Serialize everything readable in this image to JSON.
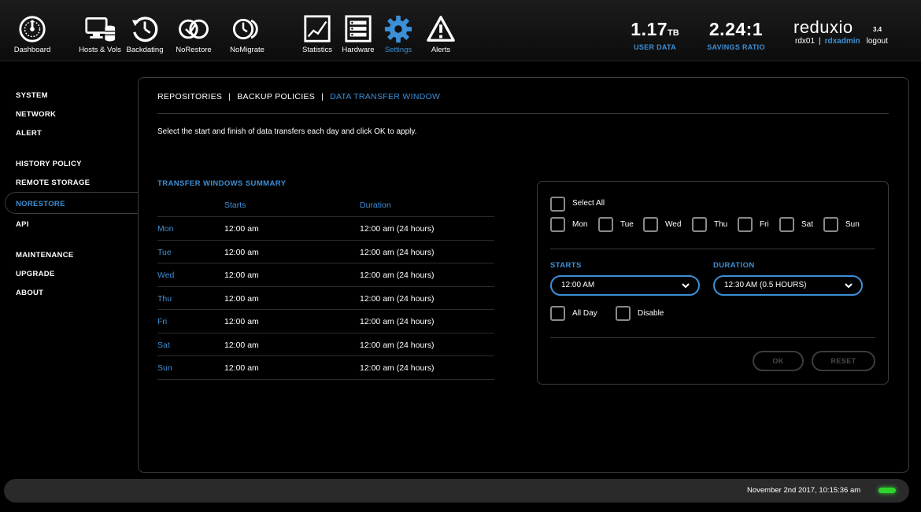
{
  "nav": {
    "items": [
      {
        "label": "Dashboard",
        "icon": "dashboard-gauge-icon"
      },
      {
        "label": "Hosts & Vols",
        "icon": "hosts-volumes-icon"
      },
      {
        "label": "Backdating",
        "icon": "backdating-clock-icon"
      },
      {
        "label": "NoRestore",
        "icon": "norestore-icon"
      },
      {
        "label": "NoMigrate",
        "icon": "nomigrate-icon"
      },
      {
        "label": "Statistics",
        "icon": "statistics-chart-icon"
      },
      {
        "label": "Hardware",
        "icon": "hardware-server-icon"
      },
      {
        "label": "Settings",
        "icon": "gear-icon"
      },
      {
        "label": "Alerts",
        "icon": "warning-icon"
      }
    ],
    "active": "Settings"
  },
  "stats": {
    "user_data": {
      "value": "1.17",
      "unit": "TB",
      "caption": "USER DATA"
    },
    "savings": {
      "value": "2.24:1",
      "caption": "SAVINGS RATIO"
    }
  },
  "brand": {
    "name": "reduxio",
    "version": "3.4"
  },
  "user": {
    "system": "rdx01",
    "separator": "|",
    "name": "rdxadmin",
    "logout": "logout"
  },
  "sidebar": {
    "items": [
      {
        "label": "SYSTEM"
      },
      {
        "label": "NETWORK"
      },
      {
        "label": "ALERT"
      },
      {
        "label": "HISTORY POLICY"
      },
      {
        "label": "REMOTE STORAGE"
      },
      {
        "label": "NORESTORE"
      },
      {
        "label": "API"
      },
      {
        "label": "MAINTENANCE"
      },
      {
        "label": "UPGRADE"
      },
      {
        "label": "ABOUT"
      }
    ],
    "active": "NORESTORE"
  },
  "tabs": {
    "repositories": "REPOSITORIES",
    "backup_policies": "BACKUP POLICIES",
    "data_transfer_window": "DATA TRANSFER WINDOW",
    "separator": "|"
  },
  "instructions": "Select the start and finish of data transfers each day and click OK to apply.",
  "summary": {
    "title": "TRANSFER WINDOWS SUMMARY",
    "headers": {
      "starts": "Starts",
      "duration": "Duration"
    },
    "rows": [
      {
        "day": "Mon",
        "starts": "12:00 am",
        "duration": "12:00 am (24 hours)"
      },
      {
        "day": "Tue",
        "starts": "12:00 am",
        "duration": "12:00 am (24 hours)"
      },
      {
        "day": "Wed",
        "starts": "12:00 am",
        "duration": "12:00 am (24 hours)"
      },
      {
        "day": "Thu",
        "starts": "12:00 am",
        "duration": "12:00 am (24 hours)"
      },
      {
        "day": "Fri",
        "starts": "12:00 am",
        "duration": "12:00 am (24 hours)"
      },
      {
        "day": "Sat",
        "starts": "12:00 am",
        "duration": "12:00 am (24 hours)"
      },
      {
        "day": "Sun",
        "starts": "12:00 am",
        "duration": "12:00 am (24 hours)"
      }
    ]
  },
  "editor": {
    "select_all": "Select All",
    "days": [
      "Mon",
      "Tue",
      "Wed",
      "Thu",
      "Fri",
      "Sat",
      "Sun"
    ],
    "starts_label": "STARTS",
    "starts_value": "12:00 AM",
    "duration_label": "DURATION",
    "duration_value": "12:30 AM (0.5 HOURS)",
    "all_day": "All Day",
    "disable": "Disable",
    "ok": "OK",
    "reset": "RESET"
  },
  "footer": {
    "datetime": "November 2nd 2017, 10:15:36 am",
    "status_color": "#2ed32e"
  },
  "colors": {
    "accent": "#3d8fd6",
    "background": "#000000"
  }
}
